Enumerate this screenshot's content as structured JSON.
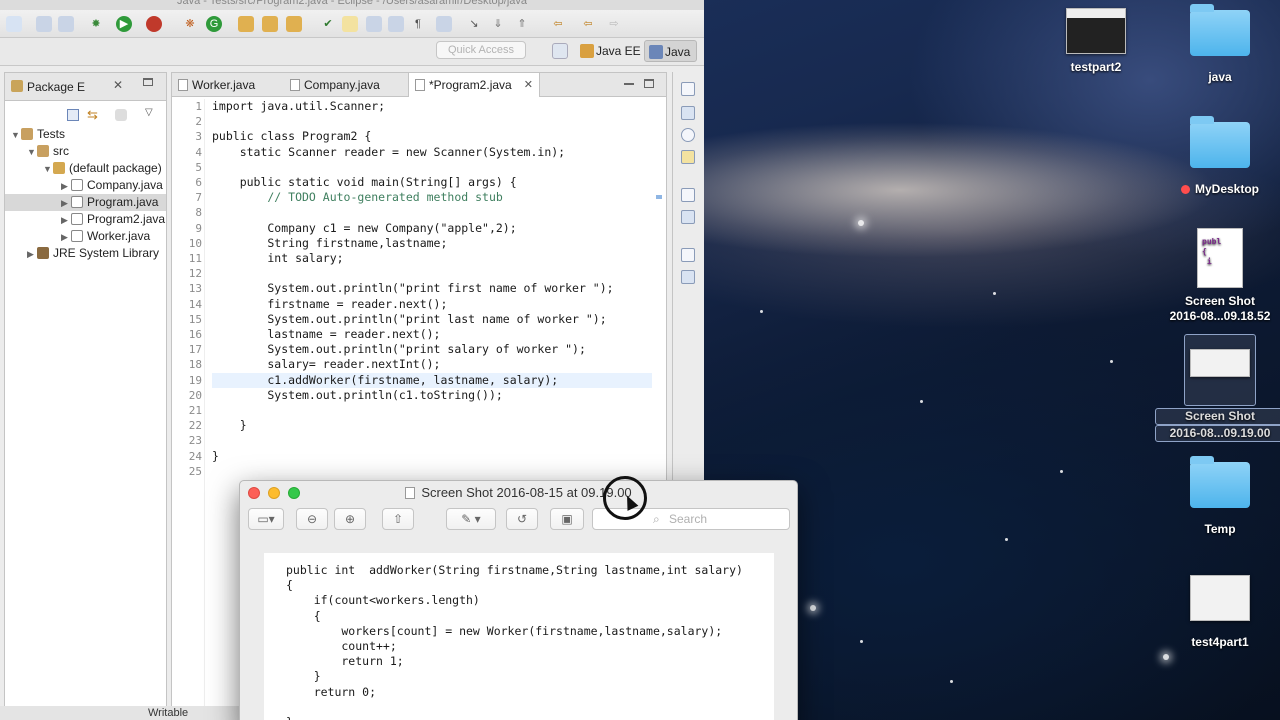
{
  "eclipse": {
    "window_title": "Java - Tests/src/Program2.java - Eclipse - /Users/asaramir/Desktop/java",
    "quick_access_placeholder": "Quick Access",
    "perspectives": [
      "Java EE",
      "Java"
    ],
    "status": "Writable",
    "package_explorer": {
      "title": "Package E",
      "tree": [
        {
          "label": "Tests",
          "level": 0
        },
        {
          "label": "src",
          "level": 1
        },
        {
          "label": "(default package)",
          "level": 2
        },
        {
          "label": "Company.java",
          "level": 3
        },
        {
          "label": "Program.java",
          "level": 3,
          "selected": true
        },
        {
          "label": "Program2.java",
          "level": 3
        },
        {
          "label": "Worker.java",
          "level": 3
        },
        {
          "label": "JRE System Library",
          "level": 1
        }
      ]
    },
    "editor": {
      "tabs": [
        "Worker.java",
        "Company.java",
        "*Program2.java"
      ],
      "active_tab": 2,
      "current_line": 19,
      "lines": [
        "import java.util.Scanner;",
        "",
        "public class Program2 {",
        "    static Scanner reader = new Scanner(System.in);",
        "",
        "    public static void main(String[] args) {",
        "        // TODO Auto-generated method stub",
        "",
        "        Company c1 = new Company(\"apple\",2);",
        "        String firstname,lastname;",
        "        int salary;",
        "",
        "        System.out.println(\"print first name of worker \");",
        "        firstname = reader.next();",
        "        System.out.println(\"print last name of worker \");",
        "        lastname = reader.next();",
        "        System.out.println(\"print salary of worker \");",
        "        salary= reader.nextInt();",
        "        c1.addWorker(firstname, lastname, salary);",
        "        System.out.println(c1.toString());",
        "",
        "    }",
        "",
        "}",
        ""
      ]
    }
  },
  "preview": {
    "title": "Screen Shot 2016-08-15 at 09.19.00",
    "search_placeholder": "Search",
    "code_lines": [
      "public int  addWorker(String firstname,String lastname,int salary)",
      "{",
      "    if(count<workers.length)",
      "    {",
      "        workers[count] = new Worker(firstname,lastname,salary);",
      "        count++;",
      "        return 1;",
      "    }",
      "    return 0;",
      "",
      "}"
    ]
  },
  "desktop": {
    "icons": [
      {
        "label": "testpart2",
        "kind": "screenshot"
      },
      {
        "label": "java",
        "kind": "folder"
      },
      {
        "label": "MyDesktop",
        "kind": "folder",
        "tag": "red"
      },
      {
        "label_line1": "Screen Shot",
        "label_line2": "2016-08...09.18.52",
        "kind": "document"
      },
      {
        "label_line1": "Screen Shot",
        "label_line2": "2016-08...09.19.00",
        "kind": "screenshot",
        "selected": true
      },
      {
        "label": "Temp",
        "kind": "folder"
      },
      {
        "label": "test4part1",
        "kind": "screenshot"
      }
    ]
  }
}
